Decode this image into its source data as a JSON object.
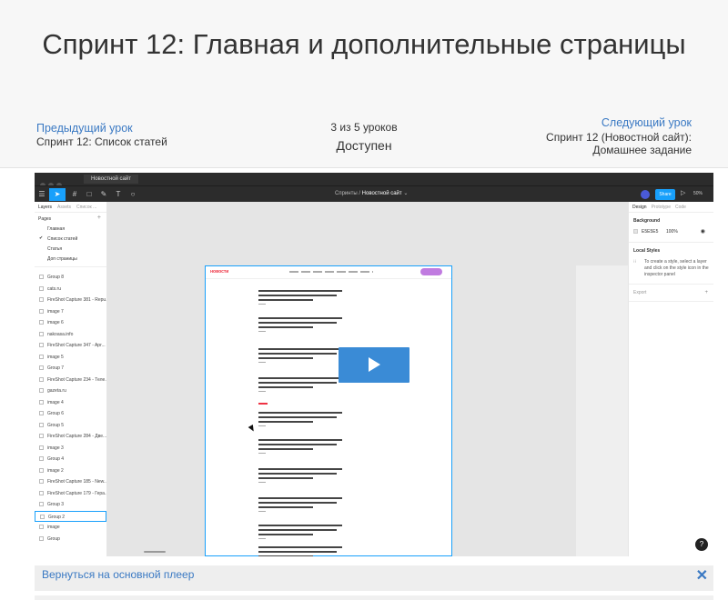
{
  "lesson": {
    "title": "Спринт 12: Главная и дополнительные страницы",
    "prev_label": "Предыдущий урок",
    "prev_name": "Спринт 12: Список статей",
    "progress": "3 из 5 уроков",
    "status": "Доступен",
    "next_label": "Следующий урок",
    "next_name_line1": "Спринт 12 (Новостной сайт):",
    "next_name_line2": "Домашнее задание"
  },
  "figma": {
    "doc_tab": "Новостной сайт",
    "breadcrumb_project": "Спринты",
    "breadcrumb_file": "Новостной сайт",
    "share_label": "Share",
    "zoom": "50%",
    "left_tabs": [
      "Layers",
      "Assets",
      "Список ..."
    ],
    "pages_header": "Pages",
    "pages": [
      "Главная",
      "Список статей",
      "Статья",
      "Доп страницы"
    ],
    "current_page": "Список статей",
    "layers": [
      "Group 8",
      "cats.ru",
      "FireShot Capture 381 - Repu...",
      "image 7",
      "image 6",
      "nakoasa.info",
      "FireShot Capture 347 - Apr...",
      "image 5",
      "Group 7",
      "FireShot Capture 234 - Теле...",
      "gazeta.ru",
      "image 4",
      "Group 6",
      "Group 5",
      "FireShot Capture 284 - Две...",
      "image 3",
      "Group 4",
      "image 2",
      "FireShot Capture 185 - New...",
      "FireShot Capture 179 - Герa...",
      "Group 3",
      "Group 2",
      "image",
      "Group"
    ],
    "right_tabs": [
      "Design",
      "Prototype",
      "Code"
    ],
    "background_title": "Background",
    "bg_hex": "E5E5E5",
    "bg_opacity": "100%",
    "local_styles_title": "Local Styles",
    "local_styles_text": "To create a style, select a layer and click on the style icon in the inspector panel",
    "export_title": "Export",
    "logo_text": "новости",
    "colors": {
      "accent": "#18a0fb",
      "dark": "#2c2c2c",
      "play": "#3a8bd6"
    }
  },
  "player": {
    "back_link": "Вернуться на основной плеер",
    "help": "?"
  }
}
